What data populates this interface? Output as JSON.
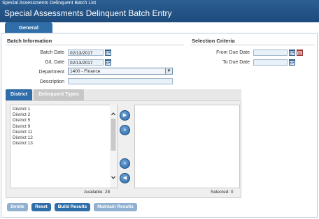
{
  "header": {
    "breadcrumb": "Special Assessments Delinquent Batch List",
    "title": "Special Assessments Delinquent Batch Entry"
  },
  "tabs": [
    {
      "label": "General",
      "active": true
    }
  ],
  "batch_info": {
    "heading": "Batch Information",
    "batch_date_label": "Batch Date",
    "batch_date_value": "02/13/2017",
    "gl_date_label": "G/L Date",
    "gl_date_value": "02/13/2017",
    "department_label": "Department",
    "department_value": "1400 - Finance",
    "description_label": "Description",
    "description_value": ""
  },
  "selection": {
    "heading": "Selection Criteria",
    "from_due_label": "From Due Date",
    "from_due_value": "",
    "to_due_label": "To Due Date",
    "to_due_value": ""
  },
  "subtabs": [
    {
      "label": "District",
      "active": true
    },
    {
      "label": "Delinquent Types",
      "active": false
    }
  ],
  "available": {
    "items": [
      "District 1",
      "District 2",
      "District 5",
      "District 9",
      "District 11",
      "District 12",
      "District 13"
    ],
    "count_text": "Available: 28"
  },
  "selected": {
    "items": [],
    "count_text": "Selected: 0"
  },
  "buttons": {
    "delete": "Delete",
    "reset": "Reset",
    "build": "Build Results",
    "maintain": "Maintain Results"
  },
  "icons": {
    "calendar": "calendar-icon",
    "move_right": "chevron-right-icon",
    "move_all_right": "double-chevron-right-icon",
    "move_all_left": "double-chevron-left-icon",
    "move_left": "chevron-left-icon"
  },
  "colors": {
    "header": "#1d4b7c",
    "accent": "#2f6ea9",
    "field_bg": "#e8f0f8"
  }
}
